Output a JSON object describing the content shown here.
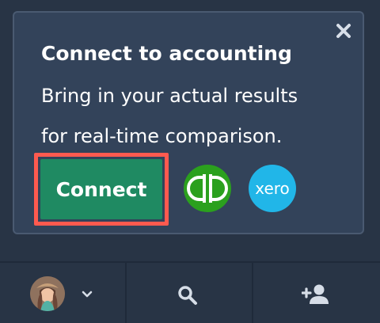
{
  "card": {
    "title": "Connect to accounting",
    "description_lines": [
      "Bring in your actual results",
      "for real-time comparison."
    ],
    "connect_button_label": "Connect",
    "close_icon": "close-icon"
  },
  "integrations": {
    "quickbooks_icon": "quickbooks-logo",
    "xero_logo_text": "xero"
  },
  "bottom_bar": {
    "avatar_icon": "avatar",
    "account_dropdown_icon": "chevron-down-icon",
    "search_icon": "search-icon",
    "add_user_icon": "add-user-icon"
  },
  "colors": {
    "background": "#283445",
    "card": "#33435a",
    "card_border": "#4a5a71",
    "primary_button": "#1f8a62",
    "highlight": "#ff5a4f",
    "quickbooks": "#2ba01e",
    "xero": "#21b6e8",
    "text": "#ffffff",
    "icon_light": "#d6dde7"
  }
}
